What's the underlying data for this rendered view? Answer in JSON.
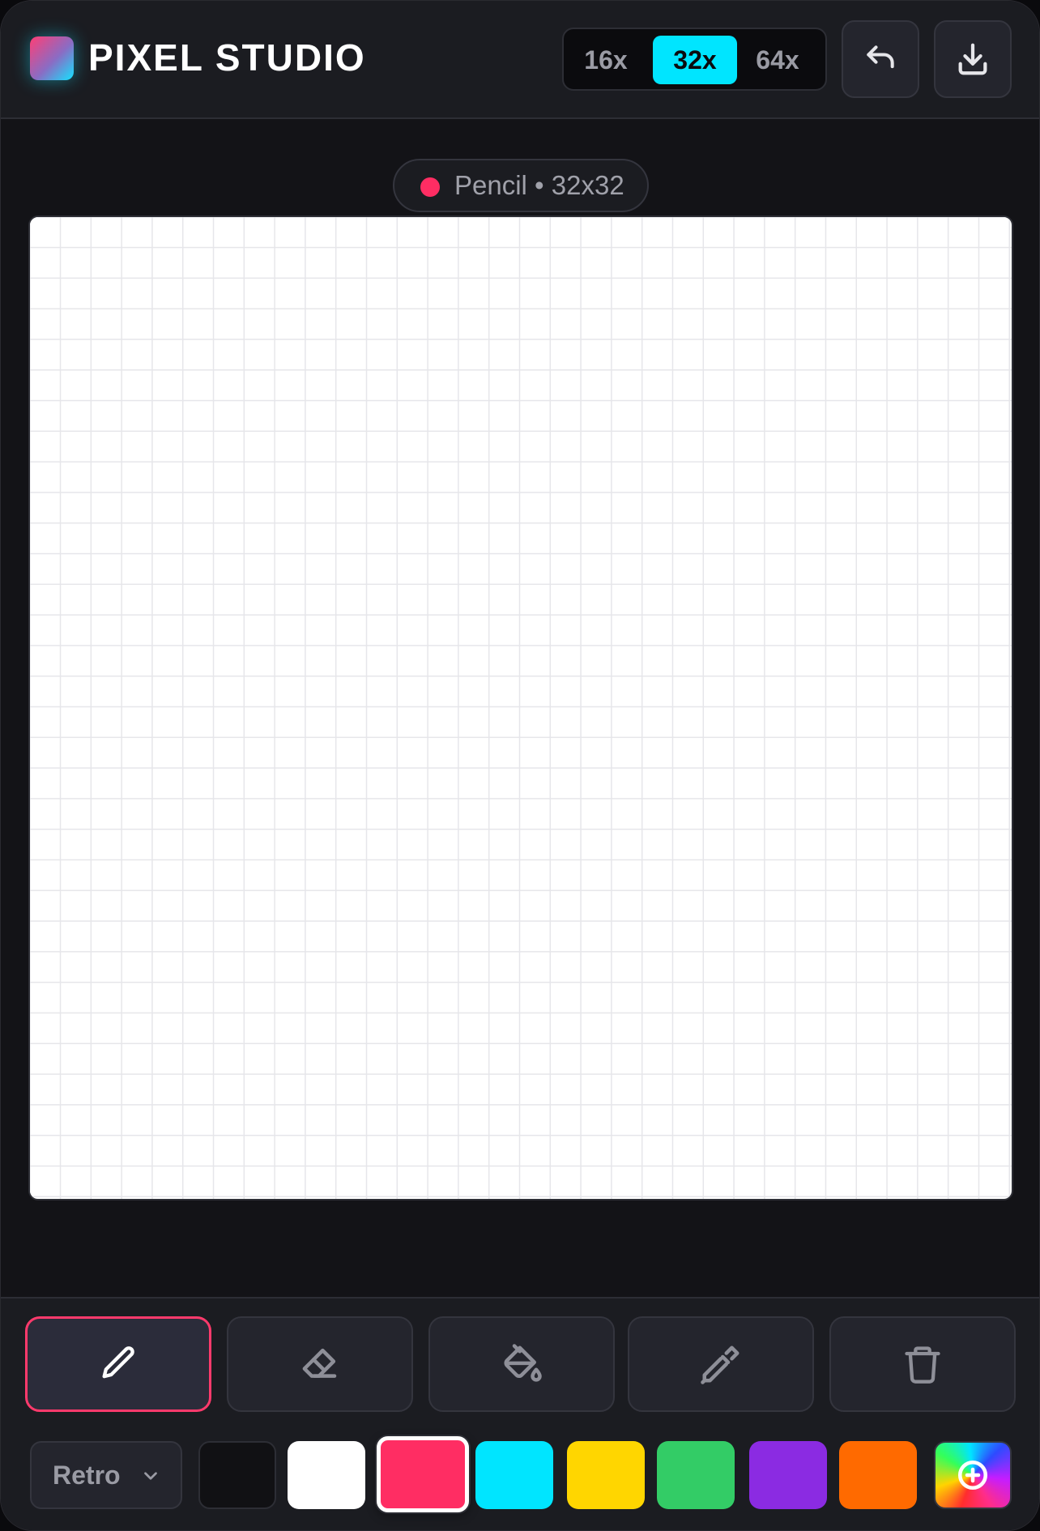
{
  "app": {
    "title": "PIXEL STUDIO",
    "logo_colors": [
      "#ff3e75",
      "#14e3ff"
    ]
  },
  "header": {
    "zoom_options": [
      {
        "label": "16x",
        "active": false
      },
      {
        "label": "32x",
        "active": true
      },
      {
        "label": "64x",
        "active": false
      }
    ],
    "undo_icon": "undo-icon",
    "download_icon": "download-icon"
  },
  "status": {
    "text": "Pencil • 32x32",
    "dot_color": "#ff2d63"
  },
  "canvas": {
    "grid_columns": 32,
    "grid_rows": 32,
    "background": "#ffffff"
  },
  "tools": [
    {
      "name": "pencil",
      "icon": "pencil-icon",
      "active": true
    },
    {
      "name": "eraser",
      "icon": "eraser-icon",
      "active": false
    },
    {
      "name": "fill",
      "icon": "paint-bucket-icon",
      "active": false
    },
    {
      "name": "eyedropper",
      "icon": "eyedropper-icon",
      "active": false
    },
    {
      "name": "clear",
      "icon": "trash-icon",
      "active": false
    }
  ],
  "palette": {
    "selected_name": "Retro",
    "swatches": [
      {
        "color": "#111114",
        "selected": false
      },
      {
        "color": "#ffffff",
        "selected": false
      },
      {
        "color": "#ff2d63",
        "selected": true
      },
      {
        "color": "#00e5ff",
        "selected": false
      },
      {
        "color": "#ffd600",
        "selected": false
      },
      {
        "color": "#33cc66",
        "selected": false
      },
      {
        "color": "#8b2be2",
        "selected": false
      },
      {
        "color": "#ff6a00",
        "selected": false
      }
    ],
    "custom_icon": "add-color-icon"
  },
  "accent_color": "#00e5ff"
}
